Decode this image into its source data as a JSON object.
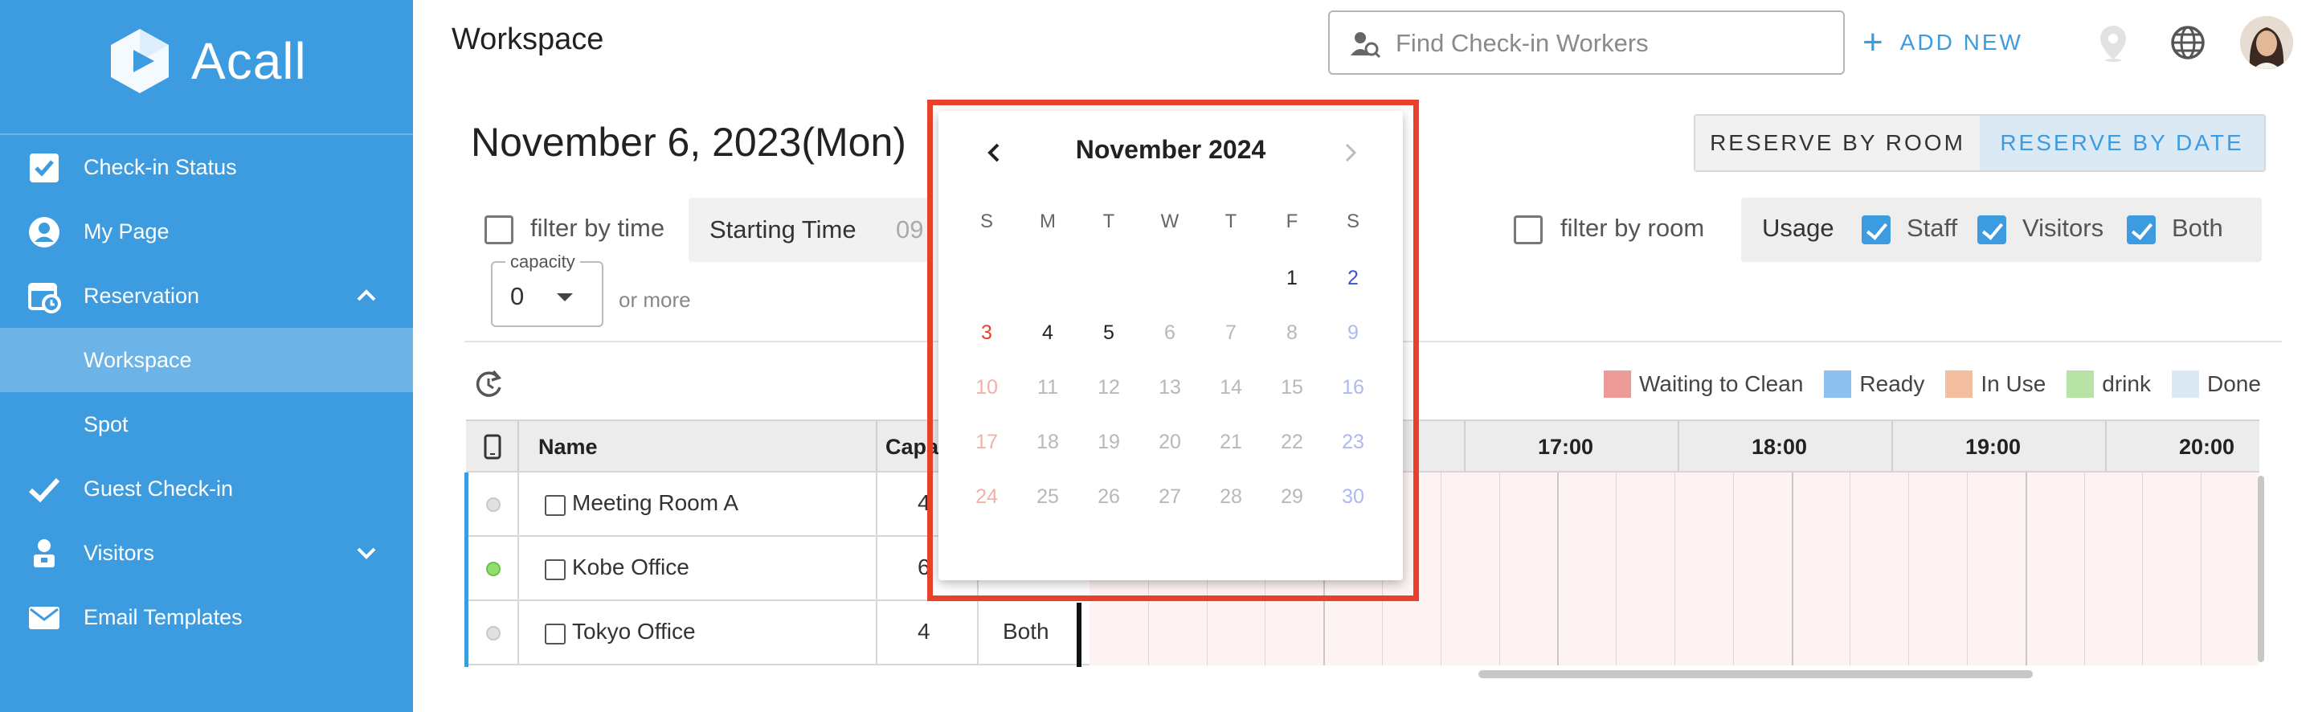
{
  "sidebar": {
    "brand": "Acall",
    "items": [
      {
        "label": "Check-in Status",
        "icon": "checkbox-icon"
      },
      {
        "label": "My Page",
        "icon": "user-icon"
      },
      {
        "label": "Reservation",
        "icon": "calendar-clock-icon",
        "expanded": true
      },
      {
        "label": "Workspace",
        "active": true
      },
      {
        "label": "Spot"
      },
      {
        "label": "Guest Check-in",
        "icon": "check-icon"
      },
      {
        "label": "Visitors",
        "icon": "visitors-icon",
        "expanded": false
      },
      {
        "label": "Email Templates",
        "icon": "mail-icon"
      }
    ]
  },
  "header": {
    "title": "Workspace",
    "search_placeholder": "Find Check-in Workers",
    "add_new": "ADD NEW"
  },
  "date_title": "November 6, 2023(Mon)",
  "tabs": {
    "room": "RESERVE BY ROOM",
    "date": "RESERVE BY DATE"
  },
  "filters": {
    "filter_by_time": "filter by time",
    "starting_time_label": "Starting Time",
    "starting_time_value": "09",
    "capacity_label": "capacity",
    "capacity_value": "0",
    "or_more": "or more",
    "filter_by_room": "filter by room",
    "usage_label": "Usage",
    "usage_options": [
      {
        "label": "Staff",
        "checked": true
      },
      {
        "label": "Visitors",
        "checked": true
      },
      {
        "label": "Both",
        "checked": true
      }
    ]
  },
  "legend": [
    {
      "label": "Waiting to Clean",
      "color": "#ee9a97"
    },
    {
      "label": "Ready",
      "color": "#8ec2ee"
    },
    {
      "label": "In Use",
      "color": "#f3bfa0"
    },
    {
      "label": "drink",
      "color": "#b7e3a6"
    },
    {
      "label": "Done",
      "color": "#dce8f4"
    }
  ],
  "table": {
    "headers": {
      "name": "Name",
      "capacity": "Capa"
    },
    "time_headers": [
      "17:00",
      "18:00",
      "19:00",
      "20:00"
    ],
    "rows": [
      {
        "name": "Meeting Room A",
        "capacity": "4",
        "usage": "",
        "status": "inactive"
      },
      {
        "name": "Kobe Office",
        "capacity": "6",
        "usage": "",
        "status": "active"
      },
      {
        "name": "Tokyo Office",
        "capacity": "4",
        "usage": "Both",
        "status": "inactive"
      }
    ]
  },
  "calendar": {
    "title": "November 2024",
    "weekdays": [
      "S",
      "M",
      "T",
      "W",
      "T",
      "F",
      "S"
    ],
    "weeks": [
      [
        "",
        "",
        "",
        "",
        "",
        "1",
        "2"
      ],
      [
        "3",
        "4",
        "5",
        "6",
        "7",
        "8",
        "9"
      ],
      [
        "10",
        "11",
        "12",
        "13",
        "14",
        "15",
        "16"
      ],
      [
        "17",
        "18",
        "19",
        "20",
        "21",
        "22",
        "23"
      ],
      [
        "24",
        "25",
        "26",
        "27",
        "28",
        "29",
        "30"
      ]
    ],
    "selectable_days": [
      "1",
      "2",
      "3",
      "4",
      "5"
    ],
    "colors": {
      "sunday": "#e8412b",
      "saturday": "#3a55d8",
      "highlight": "#e8412b"
    }
  }
}
